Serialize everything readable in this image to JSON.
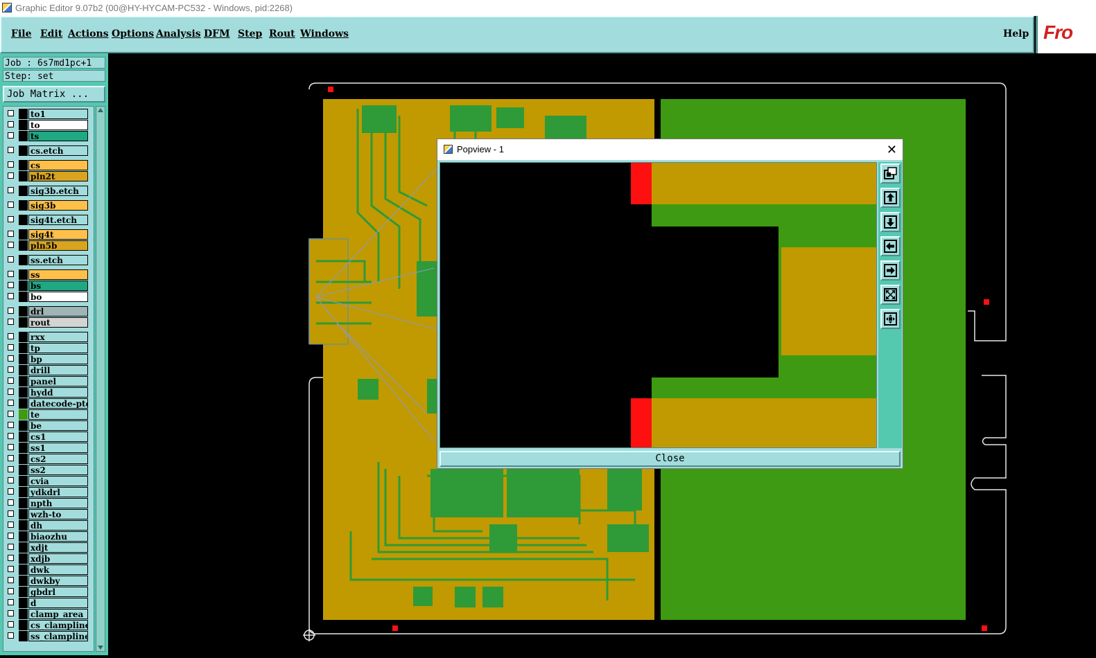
{
  "window": {
    "title": "Graphic Editor 9.07b2 (00@HY-HYCAM-PC532 - Windows, pid:2268)"
  },
  "menu": {
    "items": [
      {
        "label": "File"
      },
      {
        "label": "Edit"
      },
      {
        "label": "Actions"
      },
      {
        "label": "Options"
      },
      {
        "label": "Analysis"
      },
      {
        "label": "DFM"
      },
      {
        "label": "Step"
      },
      {
        "label": "Rout"
      },
      {
        "label": "Windows"
      }
    ],
    "help": "Help",
    "logo": "Fro"
  },
  "job": {
    "job_line": "Job : 6s7md1pc+1",
    "step_line": "Step: set",
    "matrix_button": "Job Matrix ..."
  },
  "layers": [
    {
      "name": "to1",
      "color": "#a3dcdc",
      "swatch": "#000000"
    },
    {
      "name": "to",
      "color": "#ffffff",
      "swatch": "#000000"
    },
    {
      "name": "ts",
      "color": "#1fa882",
      "swatch": "#000000"
    },
    {
      "name": "cs.etch",
      "color": "#a3dcdc",
      "swatch": "#000000"
    },
    {
      "name": "cs",
      "color": "#ffc04a",
      "swatch": "#000000"
    },
    {
      "name": "pln2t",
      "color": "#d9a41e",
      "swatch": "#000000"
    },
    {
      "name": "sig3b.etch",
      "color": "#a3dcdc",
      "swatch": "#000000"
    },
    {
      "name": "sig3b",
      "color": "#ffc04a",
      "swatch": "#000000"
    },
    {
      "name": "sig4t.etch",
      "color": "#a3dcdc",
      "swatch": "#000000"
    },
    {
      "name": "sig4t",
      "color": "#ffc04a",
      "swatch": "#000000"
    },
    {
      "name": "pln5b",
      "color": "#d9a41e",
      "swatch": "#000000"
    },
    {
      "name": "ss.etch",
      "color": "#a3dcdc",
      "swatch": "#000000"
    },
    {
      "name": "ss",
      "color": "#ffc04a",
      "swatch": "#000000"
    },
    {
      "name": "bs",
      "color": "#1fa882",
      "swatch": "#000000"
    },
    {
      "name": "bo",
      "color": "#ffffff",
      "swatch": "#000000"
    },
    {
      "name": "drl",
      "color": "#9fb4b4",
      "swatch": "#000000"
    },
    {
      "name": "rout",
      "color": "#d4d4d4",
      "swatch": "#000000"
    },
    {
      "name": "rxx",
      "color": "#a3dcdc",
      "swatch": "#000000"
    },
    {
      "name": "tp",
      "color": "#a3dcdc",
      "swatch": "#000000"
    },
    {
      "name": "bp",
      "color": "#a3dcdc",
      "swatch": "#000000"
    },
    {
      "name": "drill",
      "color": "#a3dcdc",
      "swatch": "#000000"
    },
    {
      "name": "panel",
      "color": "#a3dcdc",
      "swatch": "#000000"
    },
    {
      "name": "hydd",
      "color": "#a3dcdc",
      "swatch": "#000000"
    },
    {
      "name": "datecode-pte",
      "color": "#a3dcdc",
      "swatch": "#000000"
    },
    {
      "name": "te",
      "color": "#a3dcdc",
      "swatch": "#3e9a12"
    },
    {
      "name": "be",
      "color": "#a3dcdc",
      "swatch": "#000000"
    },
    {
      "name": "cs1",
      "color": "#a3dcdc",
      "swatch": "#000000"
    },
    {
      "name": "ss1",
      "color": "#a3dcdc",
      "swatch": "#000000"
    },
    {
      "name": "cs2",
      "color": "#a3dcdc",
      "swatch": "#000000"
    },
    {
      "name": "ss2",
      "color": "#a3dcdc",
      "swatch": "#000000"
    },
    {
      "name": "cvia",
      "color": "#a3dcdc",
      "swatch": "#000000"
    },
    {
      "name": "ydkdrl",
      "color": "#a3dcdc",
      "swatch": "#000000"
    },
    {
      "name": "npth",
      "color": "#a3dcdc",
      "swatch": "#000000"
    },
    {
      "name": "wzh-to",
      "color": "#a3dcdc",
      "swatch": "#000000"
    },
    {
      "name": "dh",
      "color": "#a3dcdc",
      "swatch": "#000000"
    },
    {
      "name": "biaozhu",
      "color": "#a3dcdc",
      "swatch": "#000000"
    },
    {
      "name": "xdjt",
      "color": "#a3dcdc",
      "swatch": "#000000"
    },
    {
      "name": "xdjb",
      "color": "#a3dcdc",
      "swatch": "#000000"
    },
    {
      "name": "dwk",
      "color": "#a3dcdc",
      "swatch": "#000000"
    },
    {
      "name": "dwkby",
      "color": "#a3dcdc",
      "swatch": "#000000"
    },
    {
      "name": "gbdrl",
      "color": "#a3dcdc",
      "swatch": "#000000"
    },
    {
      "name": "d",
      "color": "#a3dcdc",
      "swatch": "#000000"
    },
    {
      "name": "clamp_area",
      "color": "#a3dcdc",
      "swatch": "#000000"
    },
    {
      "name": "cs_clampline",
      "color": "#a3dcdc",
      "swatch": "#000000"
    },
    {
      "name": "ss_clampline",
      "color": "#a3dcdc",
      "swatch": "#000000"
    }
  ],
  "popup": {
    "title": "Popview - 1",
    "close_button": "Close",
    "tools": [
      "fit-window-icon",
      "pan-up-icon",
      "pan-down-icon",
      "pan-left-icon",
      "pan-right-icon",
      "zoom-fit-icon",
      "pan-center-icon"
    ]
  },
  "colors": {
    "board_yellow": "#c09a00",
    "board_green": "#3e9a12",
    "pad_red": "#ff1010",
    "trace_green": "#2f9a38",
    "ui_cyan": "#a3dcdc",
    "ui_teal": "#55c8b0"
  }
}
